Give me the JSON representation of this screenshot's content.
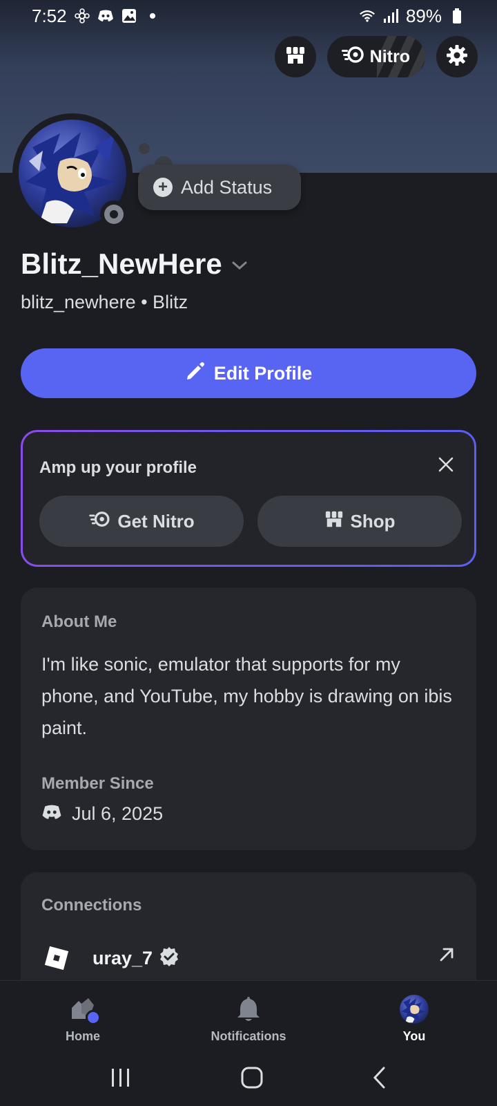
{
  "status_bar": {
    "time": "7:52",
    "battery": "89%",
    "icons": [
      "settings-flower-icon",
      "discord-icon",
      "image-icon",
      "dot-icon",
      "wifi-icon",
      "signal-icon",
      "battery-icon"
    ]
  },
  "header": {
    "nitro_label": "Nitro",
    "icons": [
      "shop-icon",
      "nitro-icon",
      "settings-gear-icon"
    ]
  },
  "profile": {
    "add_status_label": "Add Status",
    "display_name": "Blitz_NewHere",
    "handle": "blitz_newhere • Blitz",
    "edit_profile_label": "Edit Profile",
    "presence": "offline"
  },
  "amp_card": {
    "title": "Amp up your profile",
    "get_nitro_label": "Get Nitro",
    "shop_label": "Shop",
    "border_colors": [
      "#8a4ce8",
      "#5a5ff2"
    ]
  },
  "about": {
    "title": "About Me",
    "text": "I'm like sonic, emulator that supports for my phone, and YouTube, my hobby is drawing on ibis paint.",
    "member_since_title": "Member Since",
    "member_since_date": "Jul 6, 2025"
  },
  "connections": {
    "title": "Connections",
    "items": [
      {
        "service": "roblox",
        "name": "uray_7",
        "verified": true
      }
    ]
  },
  "bottom_nav": {
    "items": [
      {
        "label": "Home",
        "icon": "home-servers-icon",
        "active": false
      },
      {
        "label": "Notifications",
        "icon": "bell-icon",
        "active": false
      },
      {
        "label": "You",
        "icon": "user-avatar-icon",
        "active": true
      }
    ]
  },
  "colors": {
    "accent": "#5865f2",
    "background": "#1c1d22",
    "card": "#26272d"
  }
}
